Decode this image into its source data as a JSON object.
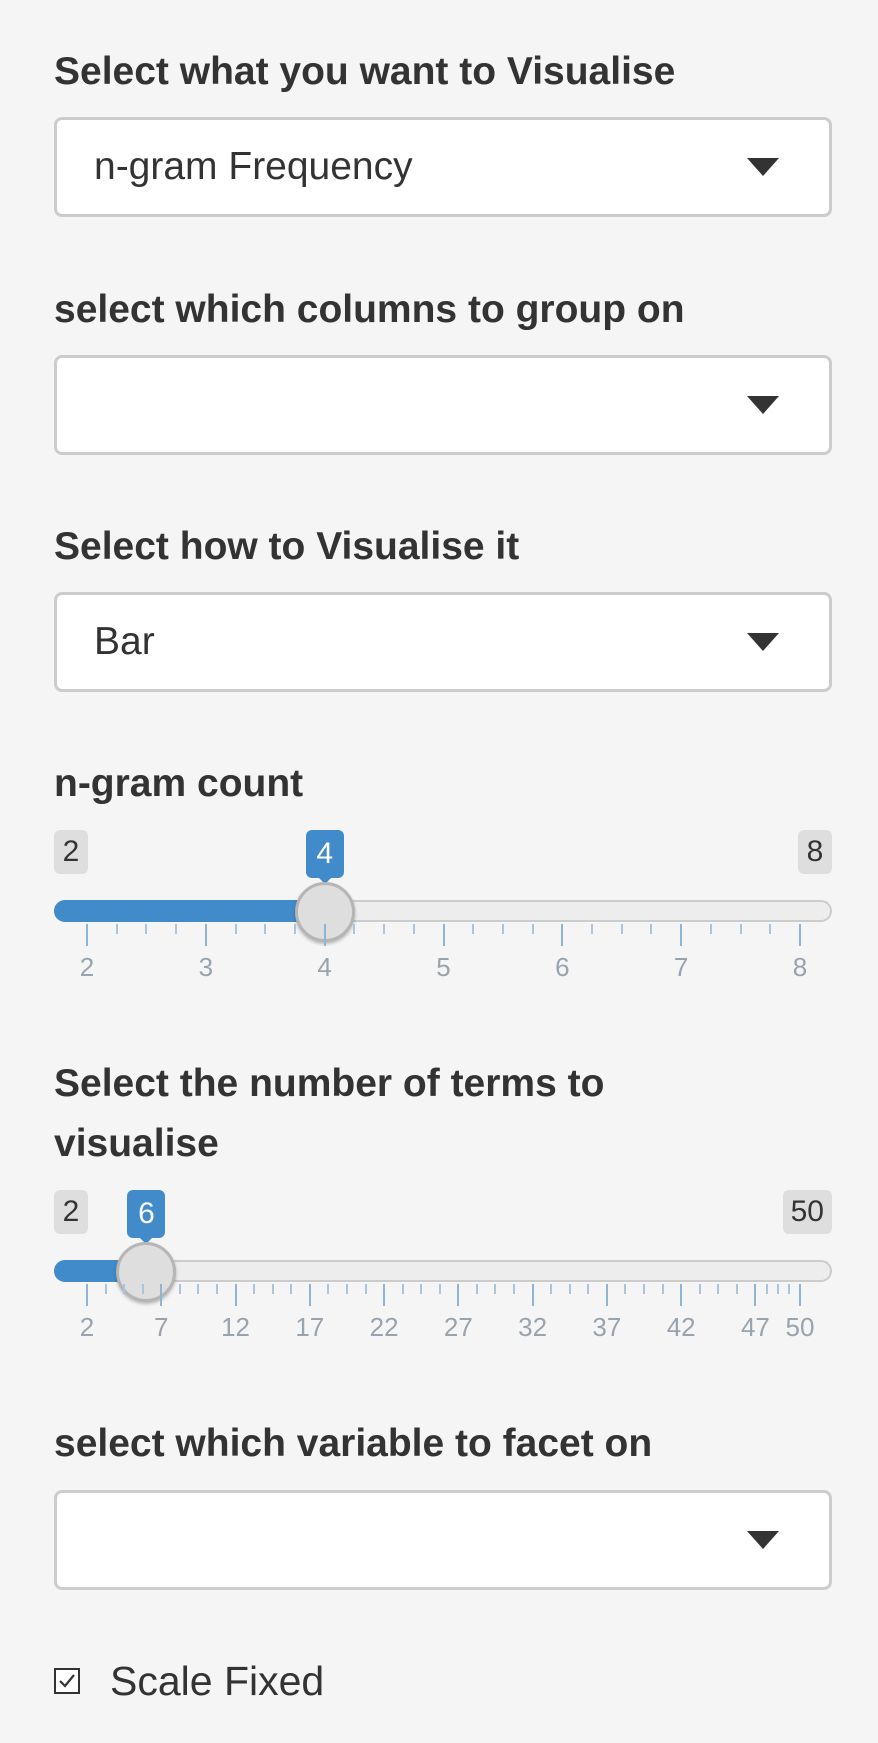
{
  "fields": {
    "visualise_what": {
      "label": "Select what you want to Visualise",
      "value": "n-gram Frequency"
    },
    "group_columns": {
      "label": "select which columns to group on",
      "value": ""
    },
    "visualise_how": {
      "label": "Select how to Visualise it",
      "value": "Bar"
    },
    "facet_variable": {
      "label": "select which variable to facet on",
      "value": ""
    }
  },
  "ngram_slider": {
    "label": "n-gram count",
    "min": 2,
    "max": 8,
    "value": 4,
    "min_label": "2",
    "max_label": "8",
    "value_label": "4",
    "major_ticks": [
      2,
      3,
      4,
      5,
      6,
      7,
      8
    ],
    "tick_labels": [
      "2",
      "3",
      "4",
      "5",
      "6",
      "7",
      "8"
    ],
    "minor_per_major": 4
  },
  "terms_slider": {
    "label_line1": "Select the number of terms to",
    "label_line2": "visualise",
    "min": 2,
    "max": 50,
    "value": 6,
    "min_label": "2",
    "max_label": "50",
    "value_label": "6",
    "major_ticks": [
      2,
      7,
      12,
      17,
      22,
      27,
      32,
      37,
      42,
      47,
      50
    ],
    "tick_labels": [
      "2",
      "7",
      "12",
      "17",
      "22",
      "27",
      "32",
      "37",
      "42",
      "47",
      "50"
    ],
    "minor_per_major": 4
  },
  "scale_fixed": {
    "label": "Scale Fixed",
    "checked": true
  },
  "colors": {
    "accent": "#428bca",
    "background": "#f5f5f5",
    "text": "#333333"
  }
}
